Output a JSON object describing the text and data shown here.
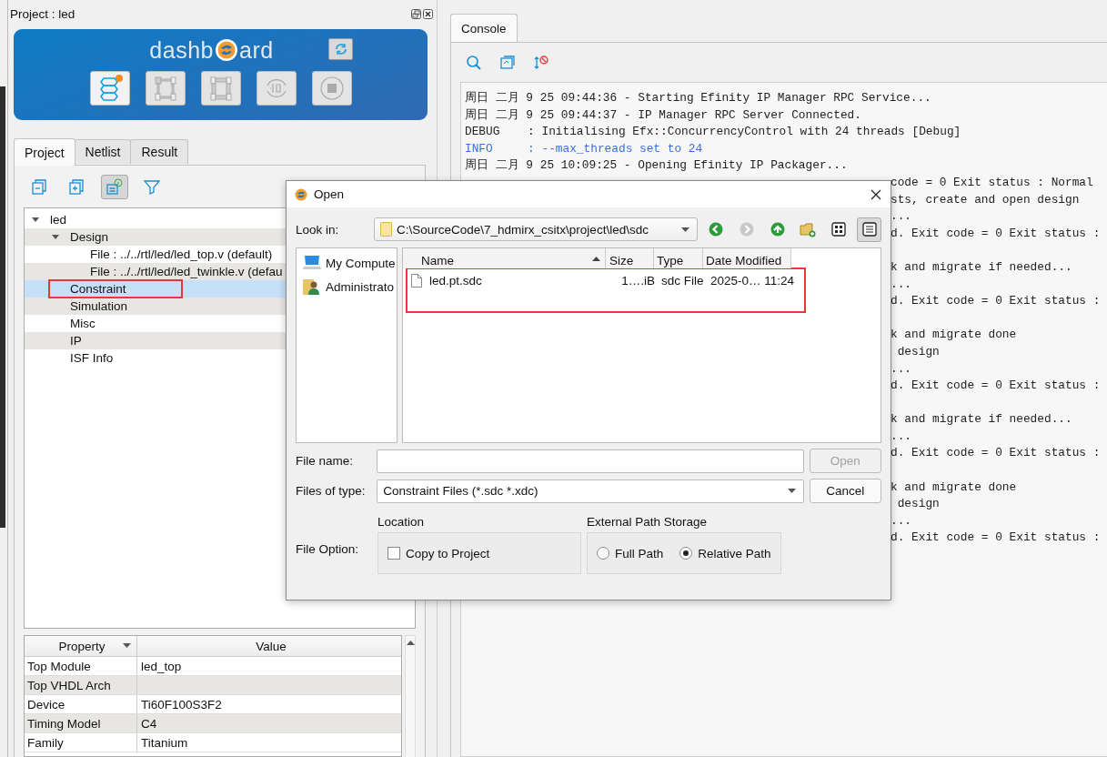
{
  "project_panel": {
    "title": "Project : led",
    "dashboard": {
      "brand_start": "dashb",
      "brand_end": "ard",
      "steps": [
        {
          "disabled": false
        },
        {
          "disabled": true
        },
        {
          "disabled": true
        },
        {
          "disabled": true
        },
        {
          "disabled": true
        }
      ]
    },
    "tabs": [
      {
        "label": "Project",
        "selected": true
      },
      {
        "label": "Netlist",
        "selected": false
      },
      {
        "label": "Result",
        "selected": false
      }
    ],
    "tools": [
      {
        "pressed": false
      },
      {
        "pressed": false
      },
      {
        "pressed": true
      },
      {
        "pressed": false
      }
    ],
    "tree": [
      {
        "label": "led",
        "expanded": true,
        "selected": false,
        "annotated": false,
        "children": [
          {
            "label": "Design",
            "expanded": true,
            "selected": false,
            "annotated": false,
            "children": [
              {
                "label": "File : ../../rtl/led/led_top.v (default)",
                "selected": false,
                "annotated": false
              },
              {
                "label": "File : ../../rtl/led/led_twinkle.v (defau",
                "selected": false,
                "annotated": false
              }
            ]
          },
          {
            "label": "Constraint",
            "selected": true,
            "annotated": true
          },
          {
            "label": "Simulation",
            "selected": false,
            "annotated": false
          },
          {
            "label": "Misc",
            "selected": false,
            "annotated": false
          },
          {
            "label": "IP",
            "selected": false,
            "annotated": false
          },
          {
            "label": "ISF Info",
            "selected": false,
            "annotated": false
          }
        ]
      }
    ],
    "properties": {
      "columns": [
        "Property",
        "Value"
      ],
      "rows": [
        {
          "name": "Top Module",
          "value": "led_top"
        },
        {
          "name": "Top VHDL Arch"
        },
        {
          "name": "Device",
          "value": "Ti60F100S3F2"
        },
        {
          "name": "Timing Model",
          "value": "C4"
        },
        {
          "name": "Family",
          "value": "Titanium"
        }
      ]
    }
  },
  "console": {
    "tab": "Console",
    "lines": [
      {
        "kind": "line",
        "text": "周日 二月 9 25 09:44:36 - Starting Efinity IP Manager RPC Service..."
      },
      {
        "kind": "line",
        "text": "周日 二月 9 25 09:44:37 - IP Manager RPC Server Connected."
      },
      {
        "kind": "line",
        "text": "DEBUG    : Initialising Efx::ConcurrencyControl with 24 threads [Debug]"
      },
      {
        "kind": "info",
        "text": "INFO     : --max_threads set to 24"
      },
      {
        "kind": "line",
        "text": "周日 二月 9 25 10:09:25 - Opening Efinity IP Packager..."
      },
      {
        "kind": "tail",
        "text": "code = 0 Exit status : Normal"
      },
      {
        "kind": "tail",
        "text": "sts, create and open design"
      },
      {
        "kind": "tail",
        "text": "..."
      },
      {
        "kind": "tail",
        "text": "d. Exit code = 0 Exit status :"
      },
      {
        "kind": "blank"
      },
      {
        "kind": "tail",
        "text": "k and migrate if needed..."
      },
      {
        "kind": "tail",
        "text": "..."
      },
      {
        "kind": "tail",
        "text": "d. Exit code = 0 Exit status :"
      },
      {
        "kind": "blank"
      },
      {
        "kind": "tail",
        "text": "k and migrate done"
      },
      {
        "kind": "tail",
        "text": " design"
      },
      {
        "kind": "tail",
        "text": "..."
      },
      {
        "kind": "tail",
        "text": "d. Exit code = 0 Exit status :"
      },
      {
        "kind": "blank"
      },
      {
        "kind": "tail",
        "text": "k and migrate if needed..."
      },
      {
        "kind": "tail",
        "text": "..."
      },
      {
        "kind": "tail",
        "text": "d. Exit code = 0 Exit status :"
      },
      {
        "kind": "blank"
      },
      {
        "kind": "tail",
        "text": "k and migrate done"
      },
      {
        "kind": "tail",
        "text": " design"
      },
      {
        "kind": "tail",
        "text": "..."
      },
      {
        "kind": "tail",
        "text": "d. Exit code = 0 Exit status :"
      }
    ]
  },
  "dialog": {
    "title": "Open",
    "look_in": {
      "label": "Look in:",
      "path": "C:\\SourceCode\\7_hdmirx_csitx\\project\\led\\sdc"
    },
    "nav": [
      {
        "disabled": false
      },
      {
        "disabled": true
      },
      {
        "disabled": false
      }
    ],
    "view_modes": [
      {
        "selected": false
      },
      {
        "selected": true
      }
    ],
    "places": [
      "My Compute",
      "Administrato"
    ],
    "columns": [
      {
        "label": "Name",
        "sorted": true
      },
      {
        "label": "Size",
        "sorted": false
      },
      {
        "label": "Type",
        "sorted": false
      },
      {
        "label": "Date Modified",
        "sorted": false
      }
    ],
    "files": [
      {
        "name": "led.pt.sdc",
        "size": "1….iB",
        "type": "sdc File",
        "modified": "2025-0… 11:24",
        "annotated": true
      }
    ],
    "file_name": {
      "label": "File name:"
    },
    "open_button": {
      "label": "Open",
      "disabled": true
    },
    "files_of_type": {
      "label": "Files of type:",
      "value": "Constraint Files (*.sdc *.xdc)"
    },
    "cancel_button": {
      "label": "Cancel"
    },
    "file_option": {
      "label": "File Option:",
      "location": {
        "title": "Location",
        "checkbox": {
          "label": "Copy to Project",
          "checked": false
        }
      },
      "path_storage": {
        "title": "External Path Storage",
        "options": [
          {
            "label": "Full Path",
            "selected": false
          },
          {
            "label": "Relative Path",
            "selected": true
          }
        ]
      }
    }
  }
}
